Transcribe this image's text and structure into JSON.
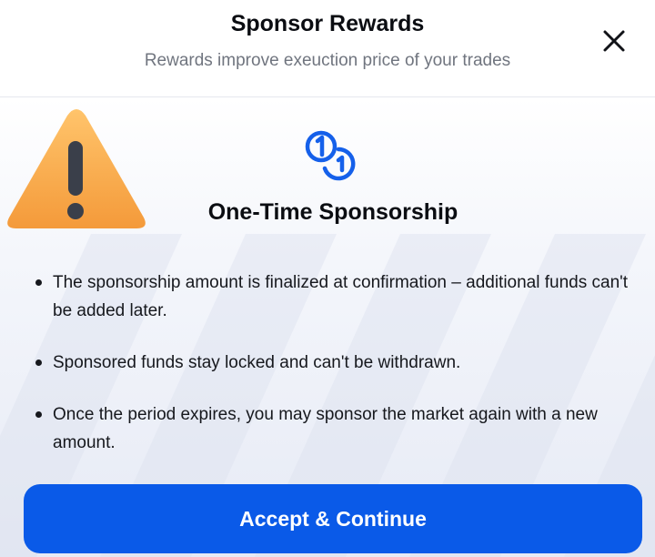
{
  "header": {
    "title": "Sponsor Rewards",
    "subtitle": "Rewards improve exeuction price of your trades",
    "close_icon": "close-icon"
  },
  "content": {
    "warning_icon": "warning-icon",
    "coins_icon": "coins-icon",
    "heading": "One-Time Sponsorship",
    "bullets": [
      "The sponsorship amount is finalized at confirmation – additional funds can't be added later.",
      "Sponsored funds stay locked and can't be withdrawn.",
      "Once the period expires, you may sponsor the market again with a new amount."
    ]
  },
  "button": {
    "label": "Accept & Continue"
  },
  "colors": {
    "accent": "#0a5ae8",
    "warning": "#f7a94a",
    "text": "#0b0d12",
    "muted": "#70757f"
  }
}
